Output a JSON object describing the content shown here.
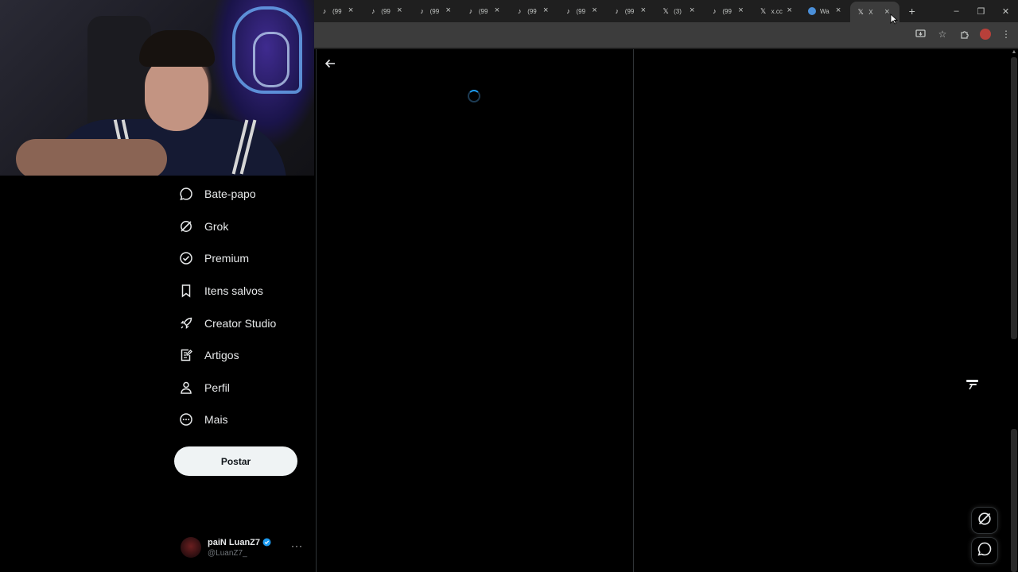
{
  "browser": {
    "tabs": [
      {
        "icon": "tiktok-icon",
        "title": "(99"
      },
      {
        "icon": "tiktok-icon",
        "title": "(99"
      },
      {
        "icon": "tiktok-icon",
        "title": "(99"
      },
      {
        "icon": "tiktok-icon",
        "title": "(99"
      },
      {
        "icon": "tiktok-icon",
        "title": "(99"
      },
      {
        "icon": "tiktok-icon",
        "title": "(99"
      },
      {
        "icon": "tiktok-icon",
        "title": "(99"
      },
      {
        "icon": "x-logo-icon",
        "title": "(3)"
      },
      {
        "icon": "tiktok-icon",
        "title": "(99"
      },
      {
        "icon": "x-logo-icon",
        "title": "x.cc"
      },
      {
        "icon": "globe-icon",
        "title": "Wa"
      },
      {
        "icon": "x-logo-icon",
        "title": "X"
      }
    ],
    "new_tab_label": "+",
    "window_controls": {
      "minimize": "–",
      "restore": "❐",
      "close": "✕"
    }
  },
  "sidebar": {
    "items": [
      {
        "id": "chat",
        "label": "Bate-papo",
        "icon": "chat-bubble-icon"
      },
      {
        "id": "grok",
        "label": "Grok",
        "icon": "grok-icon"
      },
      {
        "id": "premium",
        "label": "Premium",
        "icon": "verified-badge-icon"
      },
      {
        "id": "bookmarks",
        "label": "Itens salvos",
        "icon": "bookmark-icon"
      },
      {
        "id": "creator-studio",
        "label": "Creator Studio",
        "icon": "rocket-icon"
      },
      {
        "id": "articles",
        "label": "Artigos",
        "icon": "article-edit-icon"
      },
      {
        "id": "profile",
        "label": "Perfil",
        "icon": "person-icon"
      },
      {
        "id": "more",
        "label": "Mais",
        "icon": "more-circle-icon"
      }
    ],
    "post_label": "Postar",
    "account": {
      "name": "paiN LuanZ7",
      "handle": "@LuanZ7_",
      "more": "···"
    }
  },
  "colors": {
    "background": "#000000",
    "accent": "#1d9bf0",
    "post_button": "#eff3f4",
    "border": "#2f3336"
  }
}
